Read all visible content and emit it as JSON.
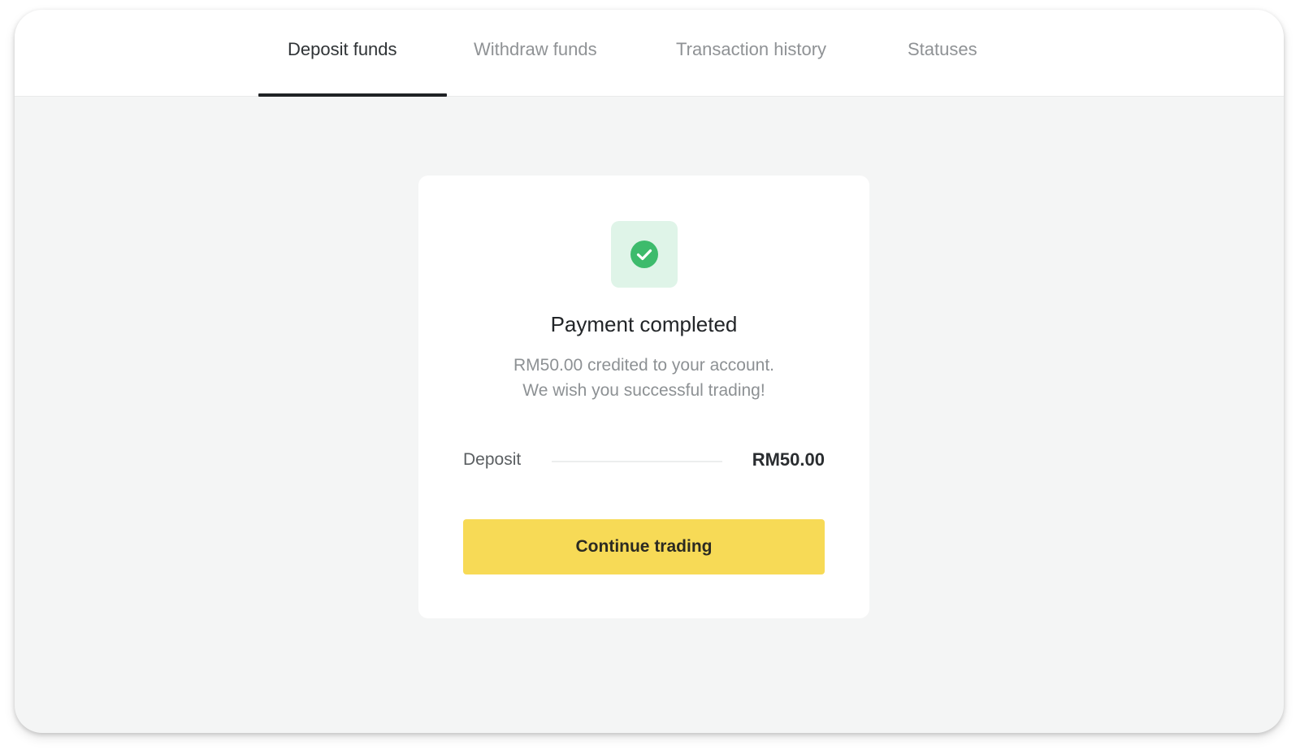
{
  "tabs": [
    {
      "label": "Deposit funds",
      "active": true
    },
    {
      "label": "Withdraw funds",
      "active": false
    },
    {
      "label": "Transaction history",
      "active": false
    },
    {
      "label": "Statuses",
      "active": false
    }
  ],
  "card": {
    "icon": "check-circle-icon",
    "title": "Payment completed",
    "message_line1": "RM50.00 credited to your account.",
    "message_line2": "We wish you successful trading!",
    "deposit_label": "Deposit",
    "deposit_value": "RM50.00",
    "button_label": "Continue trading"
  },
  "colors": {
    "accent_yellow": "#f7da56",
    "success_green": "#3dbb6c",
    "success_bg": "#dff4e8",
    "page_bg": "#f4f5f5"
  }
}
